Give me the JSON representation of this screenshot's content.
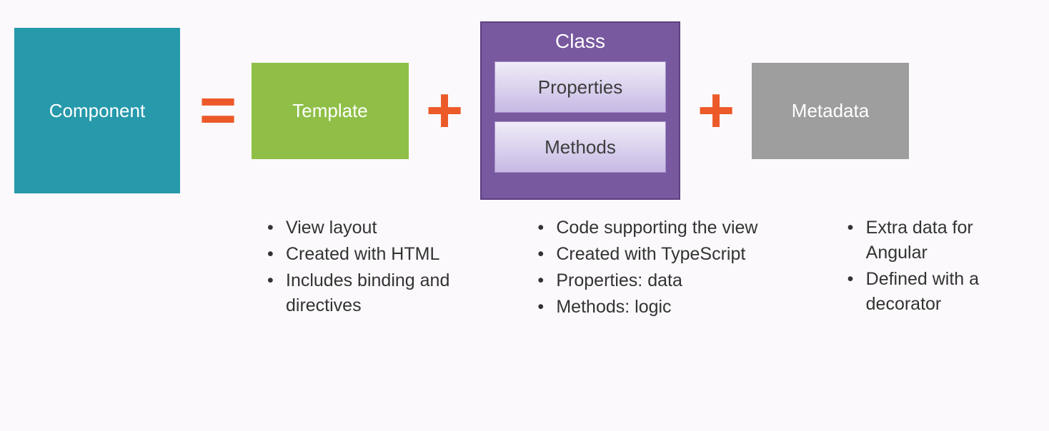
{
  "boxes": {
    "component": "Component",
    "template": "Template",
    "class_title": "Class",
    "class_inner": [
      "Properties",
      "Methods"
    ],
    "metadata": "Metadata"
  },
  "operators": {
    "equals": "=",
    "plus": "+"
  },
  "bullets": {
    "template": [
      "View layout",
      "Created with HTML",
      "Includes binding and directives"
    ],
    "class": [
      "Code supporting the view",
      "Created with TypeScript",
      "Properties: data",
      "Methods: logic"
    ],
    "metadata": [
      "Extra data for Angular",
      "Defined with a decorator"
    ]
  }
}
